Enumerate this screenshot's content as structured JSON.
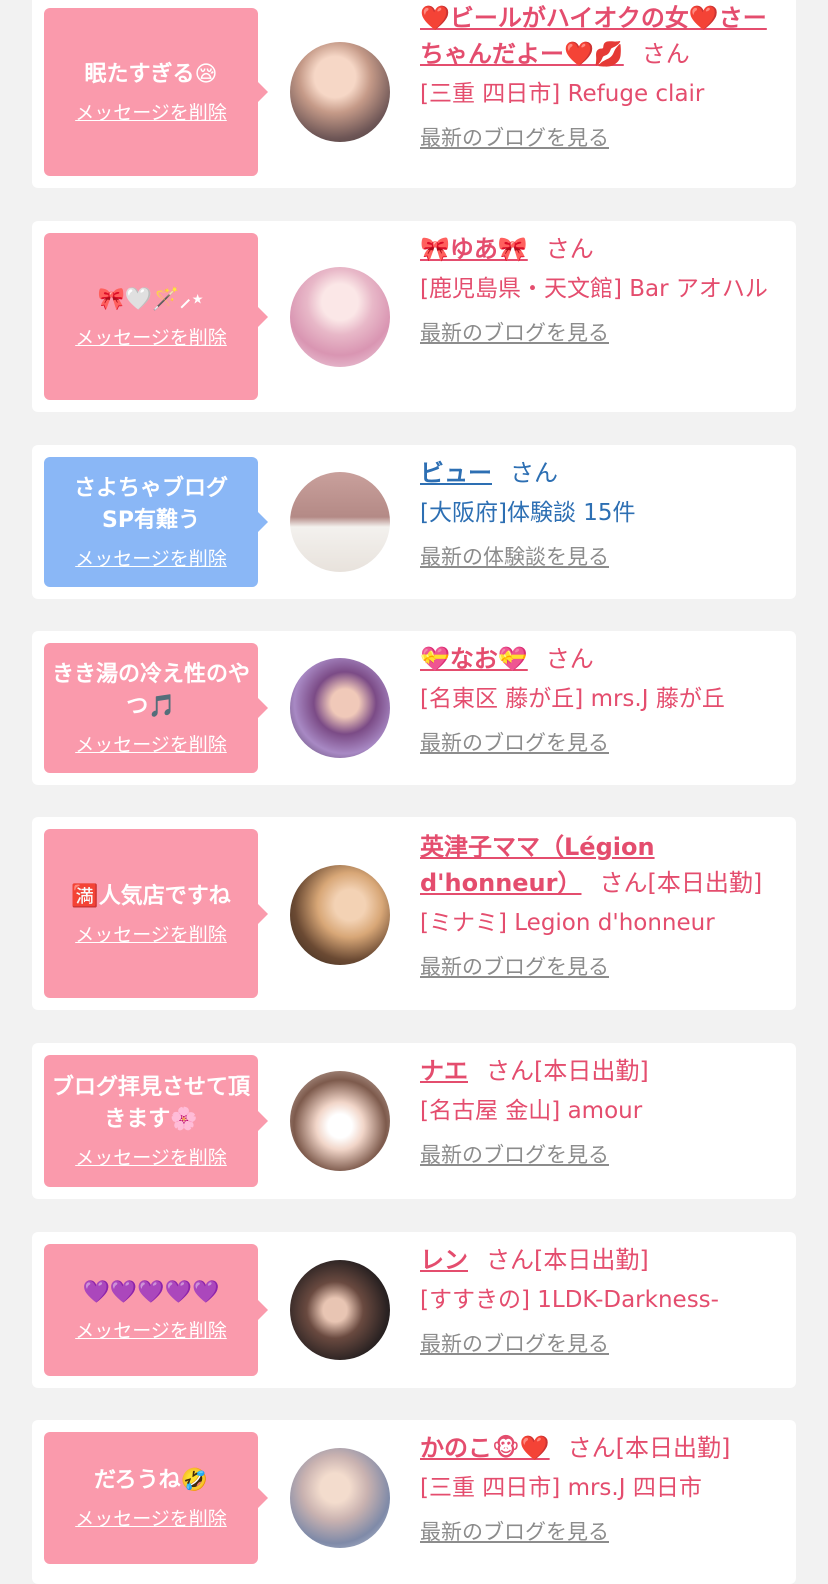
{
  "delete_label": "メッセージを削除",
  "san_label": "さん",
  "blog_link_label": "最新のブログを見る",
  "review_link_label": "最新の体験談を見る",
  "colors": {
    "pink_bubble": "#fa9aac",
    "blue_bubble": "#8ab7f6",
    "pink_text": "#e44d6e",
    "blue_text": "#2d6fb3"
  },
  "cards": [
    {
      "message": "眠たすぎる😪",
      "name": "❤️ビールがハイオクの女❤️さーちゃんだよー❤️💋",
      "badge": "",
      "shop": "[三重 四日市] Refuge clair",
      "link": "最新のブログを見る"
    },
    {
      "message": "🎀🤍🪄⸝⋆",
      "name": "🎀ゆあ🎀",
      "badge": "",
      "shop": "[鹿児島県・天文館] Bar アオハル",
      "link": "最新のブログを見る"
    },
    {
      "message": "さよちゃブログ　　　SP有難う",
      "name": "ビュー",
      "badge": "",
      "shop": "[大阪府]体験談 15件",
      "link": "最新の体験談を見る"
    },
    {
      "message": "きき湯の冷え性のやつ🎵",
      "name": "💝なお💝",
      "badge": "",
      "shop": "[名東区 藤が丘] mrs.J 藤が丘",
      "link": "最新のブログを見る"
    },
    {
      "message": "🈵人気店ですね",
      "name": "英津子ママ（Légion d'honneur）",
      "badge": "[本日出勤]",
      "shop": "[ミナミ] Legion d'honneur",
      "link": "最新のブログを見る"
    },
    {
      "message": "ブログ拝見させて頂きます🌸",
      "name": "ナエ",
      "badge": "[本日出勤]",
      "shop": "[名古屋 金山] amour",
      "link": "最新のブログを見る"
    },
    {
      "message": "💜💜💜💜💜",
      "name": "レン",
      "badge": "[本日出勤]",
      "shop": "[すすきの] 1LDK-Darkness-",
      "link": "最新のブログを見る"
    },
    {
      "message": "だろうね🤣",
      "name": "かのこ🐵❤️",
      "badge": "[本日出勤]",
      "shop": "[三重 四日市] mrs.J 四日市",
      "link": "最新のブログを見る"
    }
  ]
}
